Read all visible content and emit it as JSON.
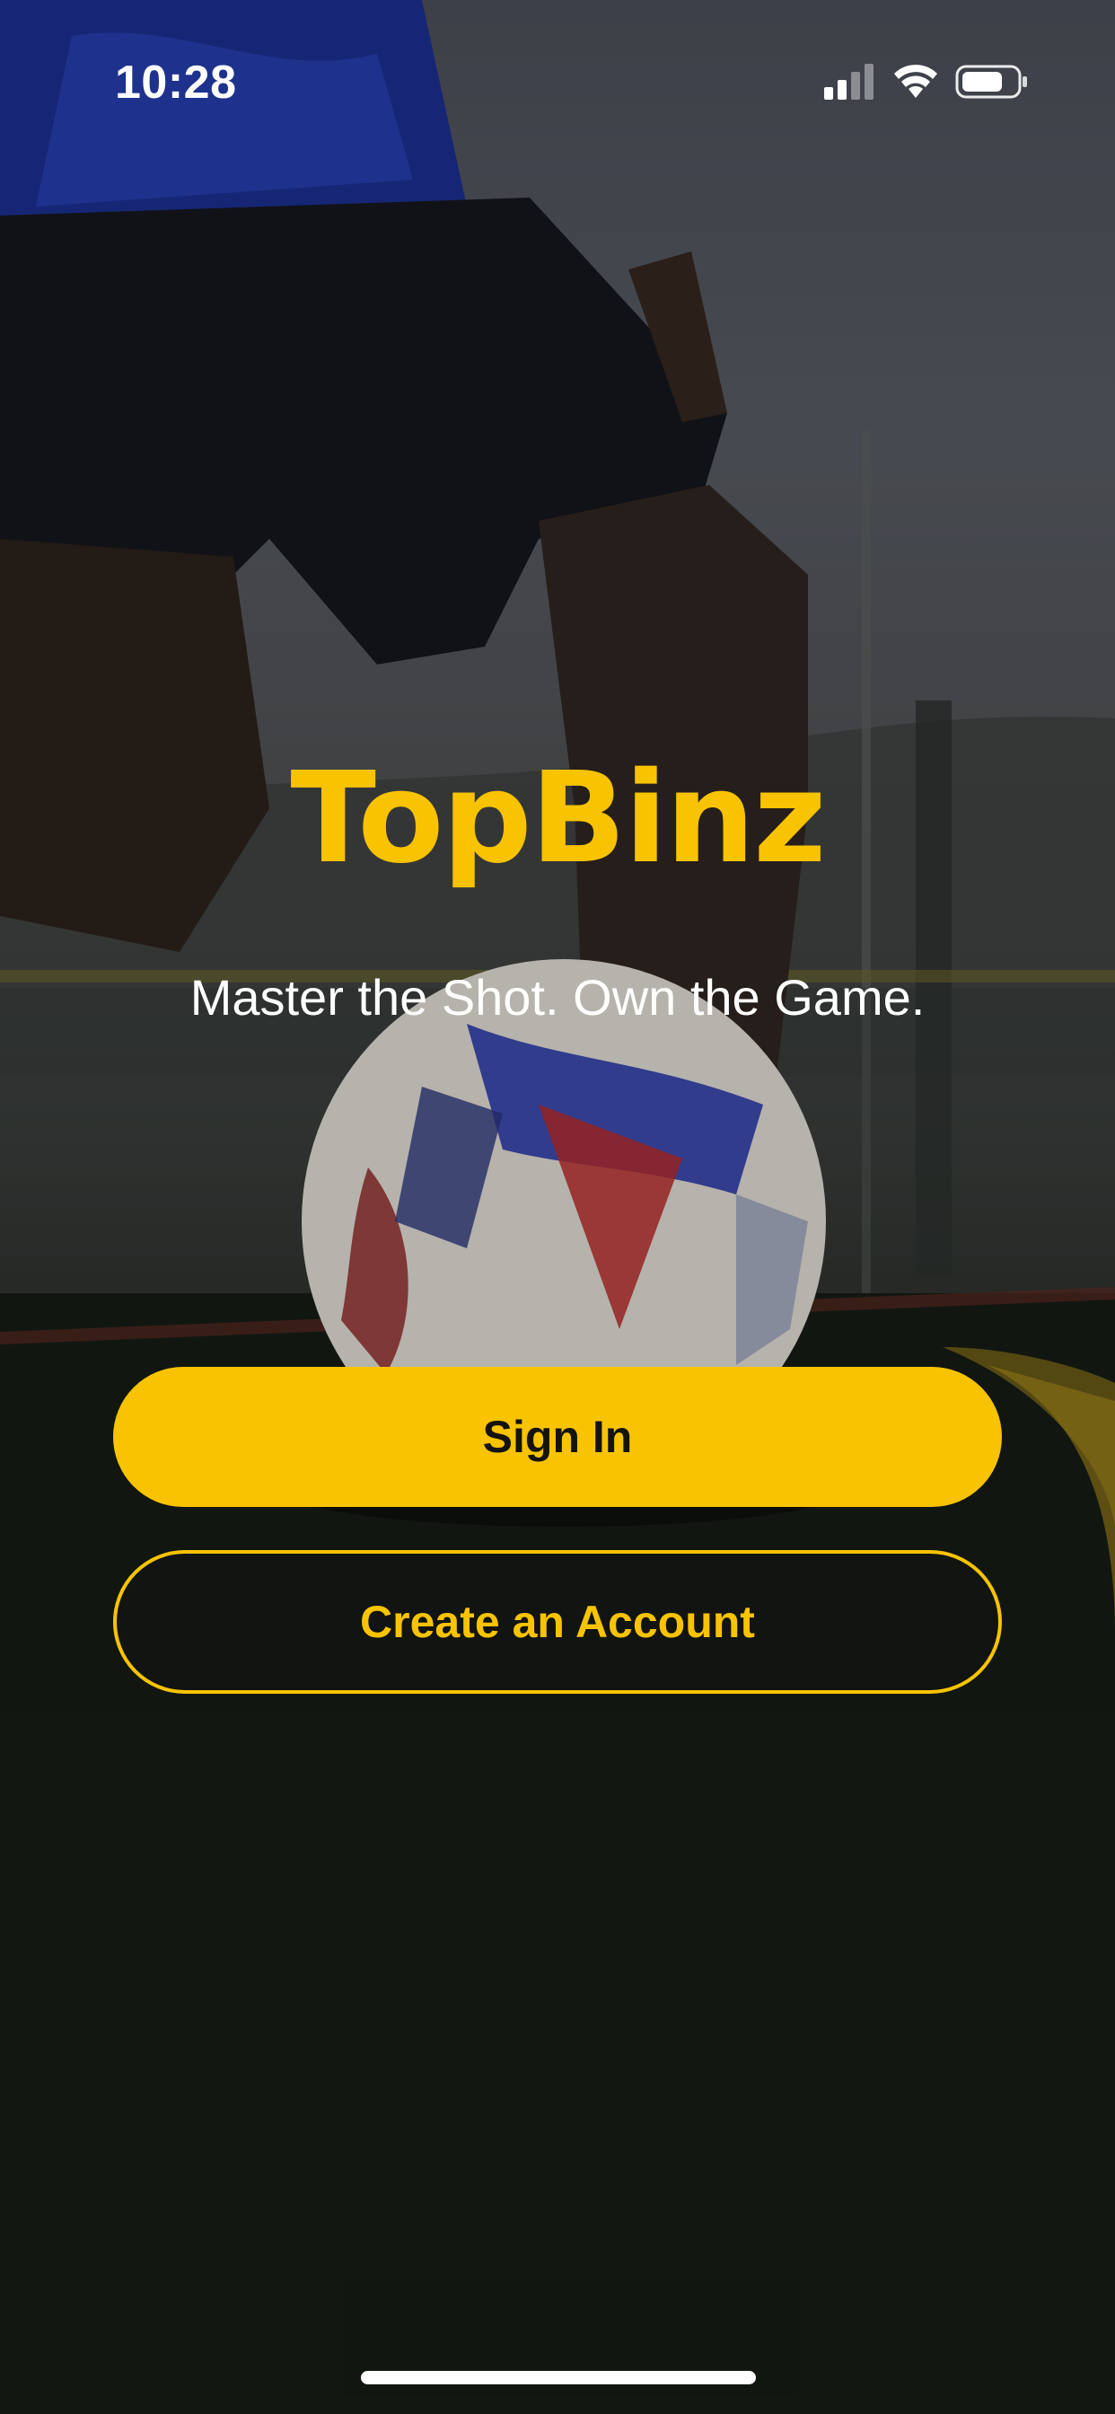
{
  "status_bar": {
    "time": "10:28",
    "icons": [
      "cellular-signal-icon",
      "wifi-icon",
      "battery-icon"
    ]
  },
  "brand": {
    "name": "TopBinz",
    "tagline": "Master the Shot. Own the Game."
  },
  "actions": {
    "sign_in_label": "Sign In",
    "create_account_label": "Create an Account"
  },
  "colors": {
    "accent": "#f8c300",
    "text_on_accent": "#15130d",
    "background_dark": "#0c0e0d",
    "text_light": "#ffffff"
  }
}
